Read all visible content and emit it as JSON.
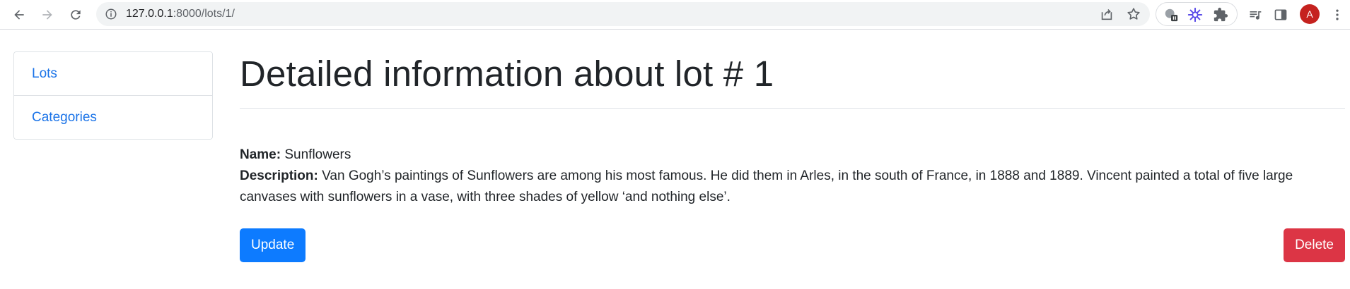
{
  "browser": {
    "url_host": "127.0.0.1",
    "url_path": ":8000/lots/1/",
    "avatar_letter": "A",
    "icons": [
      "back-icon",
      "forward-icon",
      "reload-icon",
      "info-icon",
      "share-icon",
      "star-icon",
      "translate-icon",
      "sparkle-icon",
      "puzzle-icon",
      "media-icon",
      "sidepanel-icon",
      "menu-icon"
    ]
  },
  "sidebar": {
    "items": [
      {
        "label": "Lots"
      },
      {
        "label": "Categories"
      }
    ]
  },
  "main": {
    "title": "Detailed information about lot # 1",
    "name_label": "Name:",
    "name_value": "Sunflowers",
    "description_label": "Description:",
    "description_value": "Van Gogh’s paintings of Sunflowers are among his most famous. He did them in Arles, in the south of France, in 1888 and 1889. Vincent painted a total of five large canvases with sunflowers in a vase, with three shades of yellow ‘and nothing else’.",
    "update_label": "Update",
    "delete_label": "Delete"
  },
  "colors": {
    "link": "#1a73e8",
    "primary": "#0d7bff",
    "danger": "#dc3545",
    "avatar": "#c5221f"
  }
}
